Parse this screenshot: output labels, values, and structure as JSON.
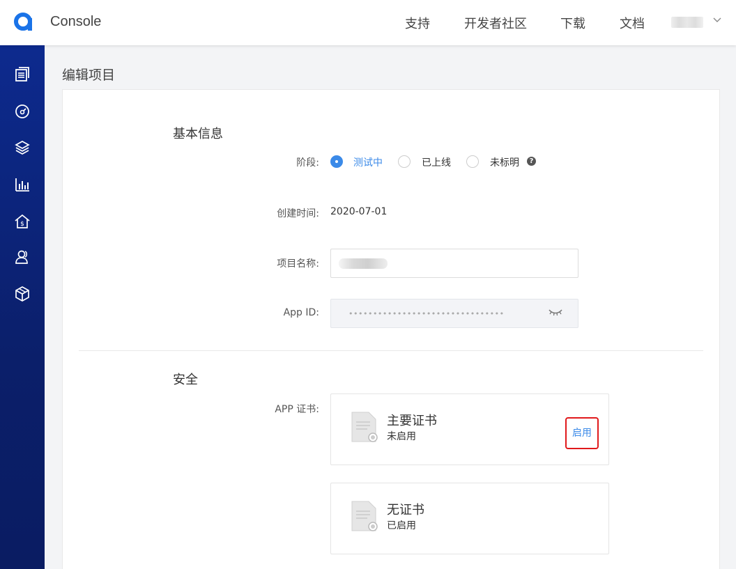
{
  "header": {
    "brand": "Console",
    "nav": [
      "支持",
      "开发者社区",
      "下载",
      "文档"
    ],
    "logo_color": "#1a73e8"
  },
  "sidebar": {
    "items": [
      {
        "icon": "document-list-icon"
      },
      {
        "icon": "gauge-icon"
      },
      {
        "icon": "layers-icon"
      },
      {
        "icon": "bar-chart-icon"
      },
      {
        "icon": "billing-icon"
      },
      {
        "icon": "users-icon"
      },
      {
        "icon": "cube-icon"
      }
    ],
    "color": "#0d2a8e"
  },
  "page": {
    "title": "编辑项目"
  },
  "basic_info": {
    "section_title": "基本信息",
    "stage_label": "阶段:",
    "stage_options": [
      "测试中",
      "已上线",
      "未标明"
    ],
    "stage_selected": "测试中",
    "created_label": "创建时间:",
    "created_value": "2020-07-01",
    "name_label": "项目名称:",
    "appid_label": "App ID:",
    "appid_masked": "••••••••••••••••••••••••••••••••"
  },
  "security": {
    "section_title": "安全",
    "cert_label": "APP 证书:",
    "certs": [
      {
        "title": "主要证书",
        "status": "未启用",
        "action": "启用"
      },
      {
        "title": "无证书",
        "status": "已启用"
      }
    ],
    "accent_color": "#3b8ae8",
    "highlight_color": "#e0191b"
  }
}
